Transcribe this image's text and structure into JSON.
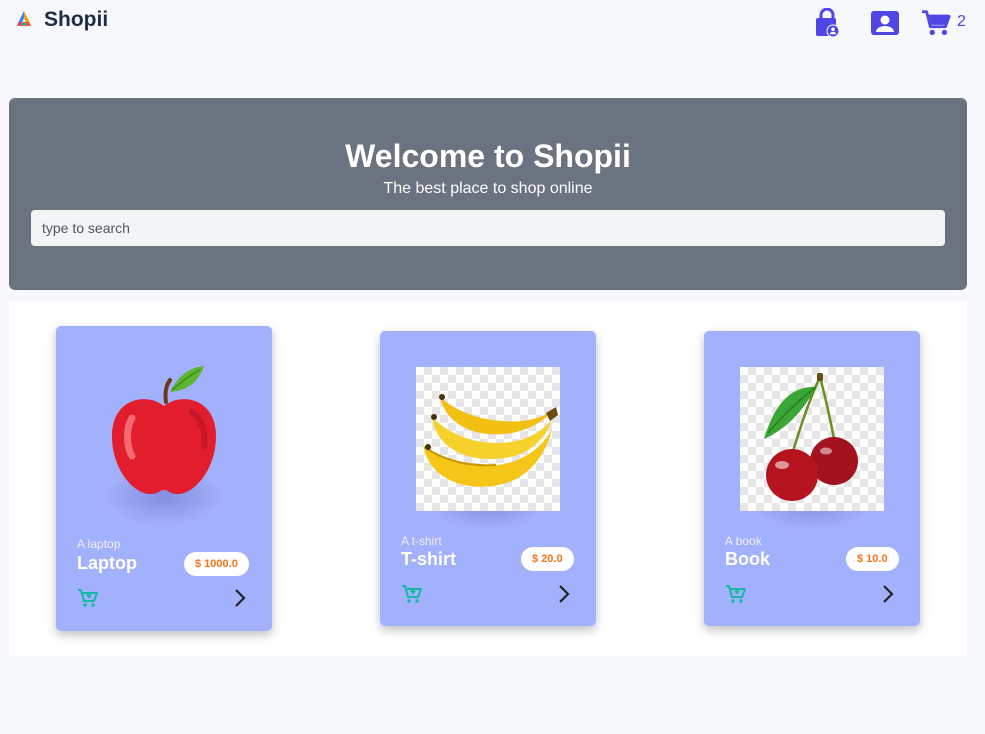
{
  "header": {
    "brand": "Shopii",
    "icons": [
      "logo-icon",
      "lock-person-icon",
      "account-box-icon",
      "shopping-cart-icon"
    ],
    "cart_count": "2",
    "accent_color": "#4f46e5"
  },
  "hero": {
    "title": "Welcome to Shopii",
    "subtitle": "The best place to shop online",
    "search_placeholder": "type to search",
    "search_value": "",
    "background": "#6b7280"
  },
  "products": [
    {
      "subtitle": "A laptop",
      "name": "Laptop",
      "price": "$ 1000.0",
      "image": "apple-image"
    },
    {
      "subtitle": "A t-shirt",
      "name": "T-shirt",
      "price": "$ 20.0",
      "image": "banana-image"
    },
    {
      "subtitle": "A book",
      "name": "Book",
      "price": "$ 10.0",
      "image": "cherry-image"
    }
  ],
  "colors": {
    "card": "#a3b0fb",
    "price_text": "#f97316",
    "add_cart_icon": "#14b8a6"
  }
}
